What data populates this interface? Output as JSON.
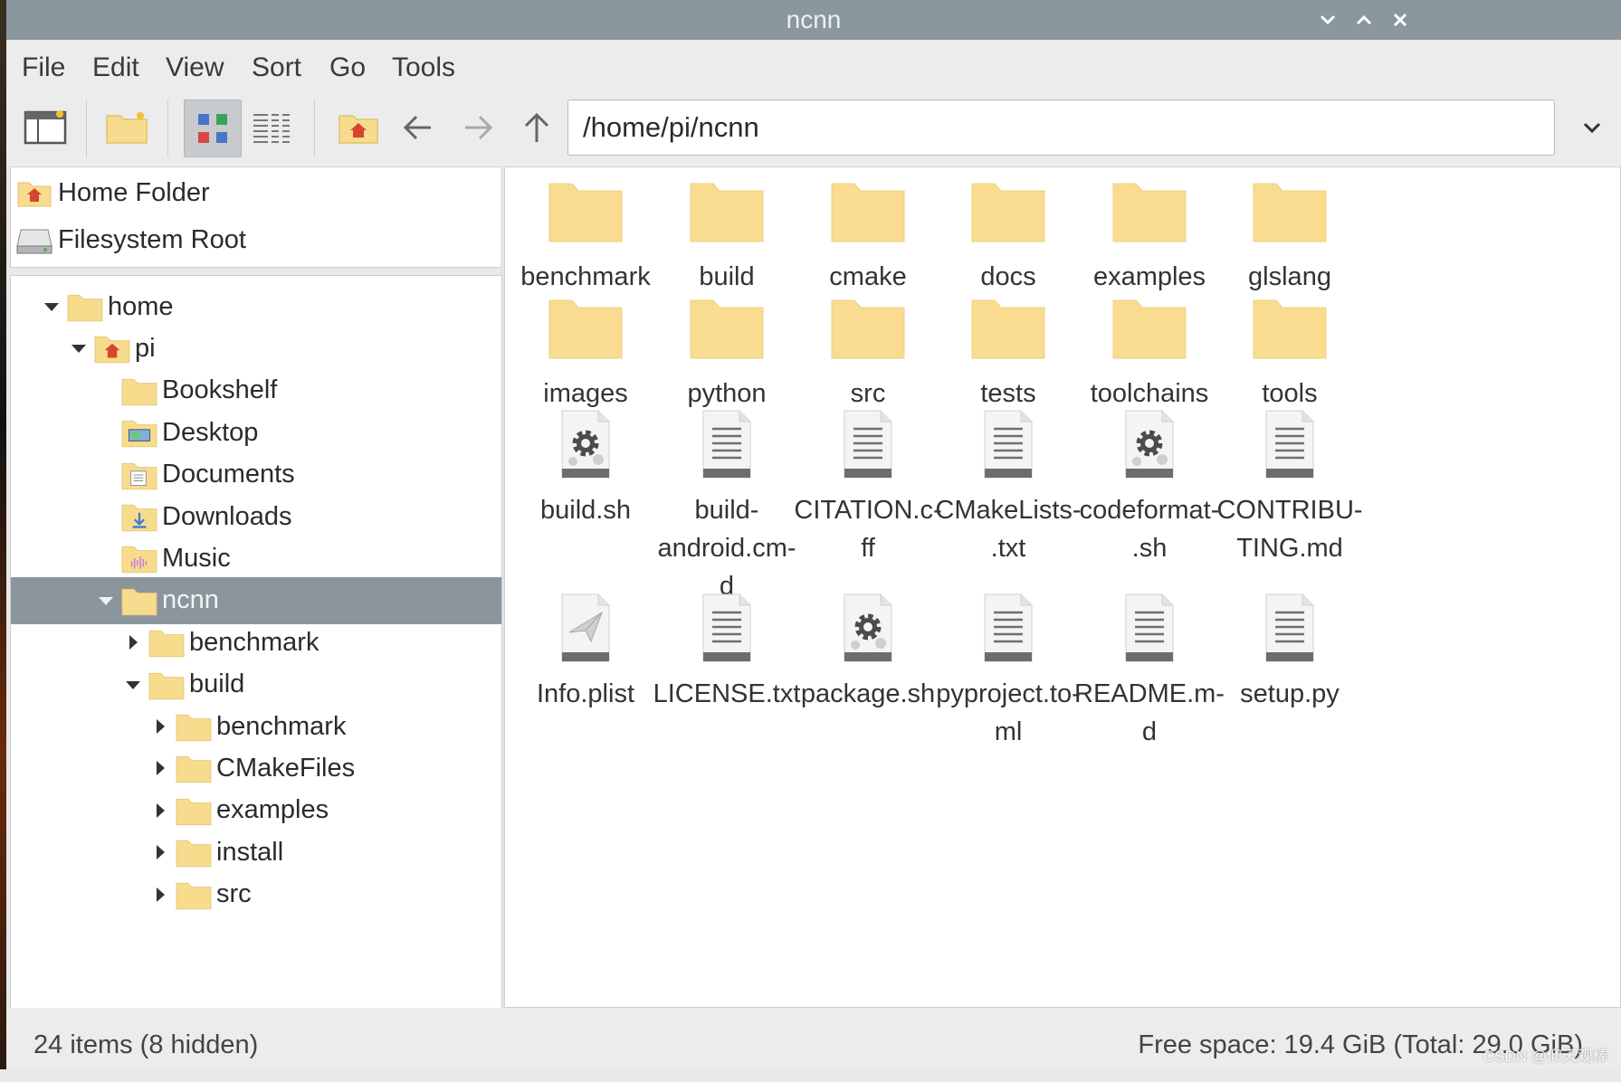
{
  "window": {
    "title": "ncnn"
  },
  "menu": [
    "File",
    "Edit",
    "View",
    "Sort",
    "Go",
    "Tools"
  ],
  "path": "/home/pi/ncnn",
  "places": [
    {
      "label": "Home Folder",
      "icon": "home-folder-icon"
    },
    {
      "label": "Filesystem Root",
      "icon": "drive-icon"
    }
  ],
  "tree": [
    {
      "label": "home",
      "depth": 0,
      "expander": "open"
    },
    {
      "label": "pi",
      "depth": 1,
      "expander": "open",
      "icon": "home-folder-icon"
    },
    {
      "label": "Bookshelf",
      "depth": 2
    },
    {
      "label": "Desktop",
      "depth": 2,
      "icon": "desktop-folder-icon"
    },
    {
      "label": "Documents",
      "depth": 2,
      "icon": "documents-folder-icon"
    },
    {
      "label": "Downloads",
      "depth": 2,
      "icon": "downloads-folder-icon"
    },
    {
      "label": "Music",
      "depth": 2,
      "icon": "music-folder-icon"
    },
    {
      "label": "ncnn",
      "depth": 3,
      "expander": "open",
      "selected": true
    },
    {
      "label": "benchmark",
      "depth": 4,
      "expander": "closed"
    },
    {
      "label": "build",
      "depth": 4,
      "expander": "open"
    },
    {
      "label": "benchmark",
      "depth": 5,
      "expander": "closed"
    },
    {
      "label": "CMakeFiles",
      "depth": 5,
      "expander": "closed"
    },
    {
      "label": "examples",
      "depth": 5,
      "expander": "closed"
    },
    {
      "label": "install",
      "depth": 5,
      "expander": "closed"
    },
    {
      "label": "src",
      "depth": 5,
      "expander": "closed"
    }
  ],
  "files": [
    {
      "name": "benchmark",
      "type": "folder"
    },
    {
      "name": "build",
      "type": "folder"
    },
    {
      "name": "cmake",
      "type": "folder"
    },
    {
      "name": "docs",
      "type": "folder"
    },
    {
      "name": "examples",
      "type": "folder"
    },
    {
      "name": "glslang",
      "type": "folder"
    },
    {
      "name": "images",
      "type": "folder"
    },
    {
      "name": "python",
      "type": "folder"
    },
    {
      "name": "src",
      "type": "folder"
    },
    {
      "name": "tests",
      "type": "folder"
    },
    {
      "name": "toolchains",
      "type": "folder"
    },
    {
      "name": "tools",
      "type": "folder"
    },
    {
      "name": "build.sh",
      "type": "script"
    },
    {
      "name": "build-android.cmd",
      "type": "text",
      "display": "build-\nandroid.cm-\nd"
    },
    {
      "name": "CITATION.cff",
      "type": "text",
      "display": "CITATION.c-\nff"
    },
    {
      "name": "CMakeLists.txt",
      "type": "text",
      "display": "CMakeLists-\n.txt"
    },
    {
      "name": "codeformat.sh",
      "type": "script",
      "display": "codeformat-\n.sh"
    },
    {
      "name": "CONTRIBUTING.md",
      "type": "text",
      "display": "CONTRIBU-\nTING.md"
    },
    {
      "name": "Info.plist",
      "type": "plist"
    },
    {
      "name": "LICENSE.txt",
      "type": "text"
    },
    {
      "name": "package.sh",
      "type": "script"
    },
    {
      "name": "pyproject.toml",
      "type": "text",
      "display": "pyproject.to-\nml"
    },
    {
      "name": "README.md",
      "type": "text",
      "display": "README.m-\nd"
    },
    {
      "name": "setup.py",
      "type": "text"
    }
  ],
  "status": {
    "items": "24 items (8 hidden)",
    "free": "Free space: 19.4 GiB (Total: 29.0 GiB)"
  },
  "watermark": "CSDN @仰天观棒",
  "colors": {
    "titlebar": "#8b979e",
    "selection": "#8a959c",
    "folder": "#f8dc8e"
  }
}
